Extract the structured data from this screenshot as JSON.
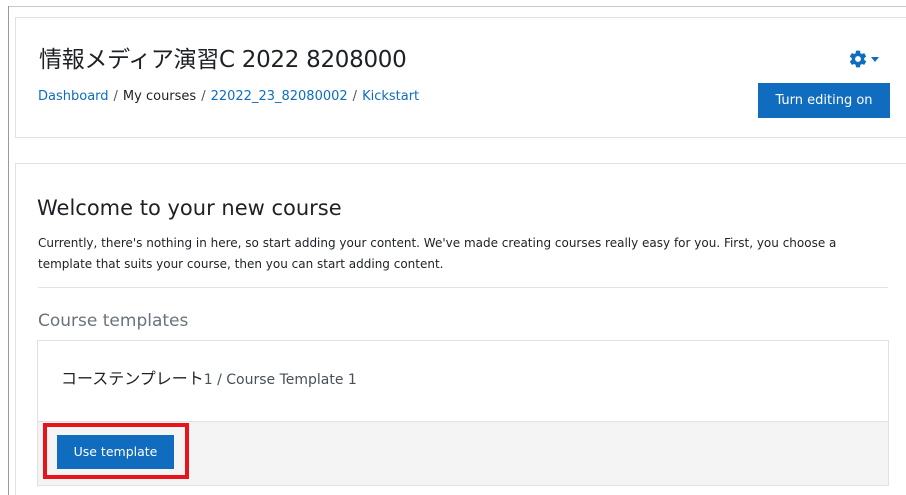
{
  "course": {
    "title": "情報メディア演習C 2022 8208000"
  },
  "breadcrumb": {
    "items": [
      "Dashboard",
      "My courses",
      "22022_23_82080002",
      "Kickstart"
    ],
    "separator": "/"
  },
  "header": {
    "settings_icon": "gear-icon",
    "edit_button_label": "Turn editing on"
  },
  "welcome": {
    "heading": "Welcome to your new course",
    "text": "Currently, there's nothing in here, so start adding your content. We've made creating courses really easy for you. First, you choose a template that suits your course, then you can start adding content."
  },
  "templates": {
    "heading": "Course templates",
    "items": [
      {
        "name_ja": "コーステンプレート",
        "name_rest": "1 / Course Template 1",
        "button_label": "Use template"
      }
    ]
  },
  "colors": {
    "primary": "#0f6cbf",
    "highlight": "#e8141b",
    "muted_heading": "#6a737b",
    "footer_bg": "#f4f4f4"
  }
}
